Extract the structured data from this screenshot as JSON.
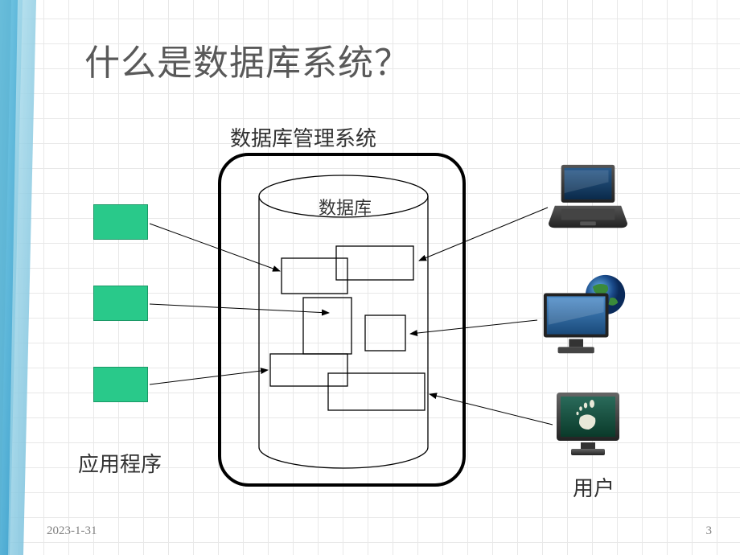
{
  "title": "什么是数据库系统？",
  "labels": {
    "dbms": "数据库管理系统",
    "database": "数据库",
    "applications": "应用程序",
    "users": "用户"
  },
  "footer": {
    "date": "2023-1-31",
    "page": "3"
  },
  "icons": {
    "laptop": "laptop-icon",
    "monitor_globe": "monitor-globe-icon",
    "gnome_monitor": "gnome-monitor-icon"
  }
}
